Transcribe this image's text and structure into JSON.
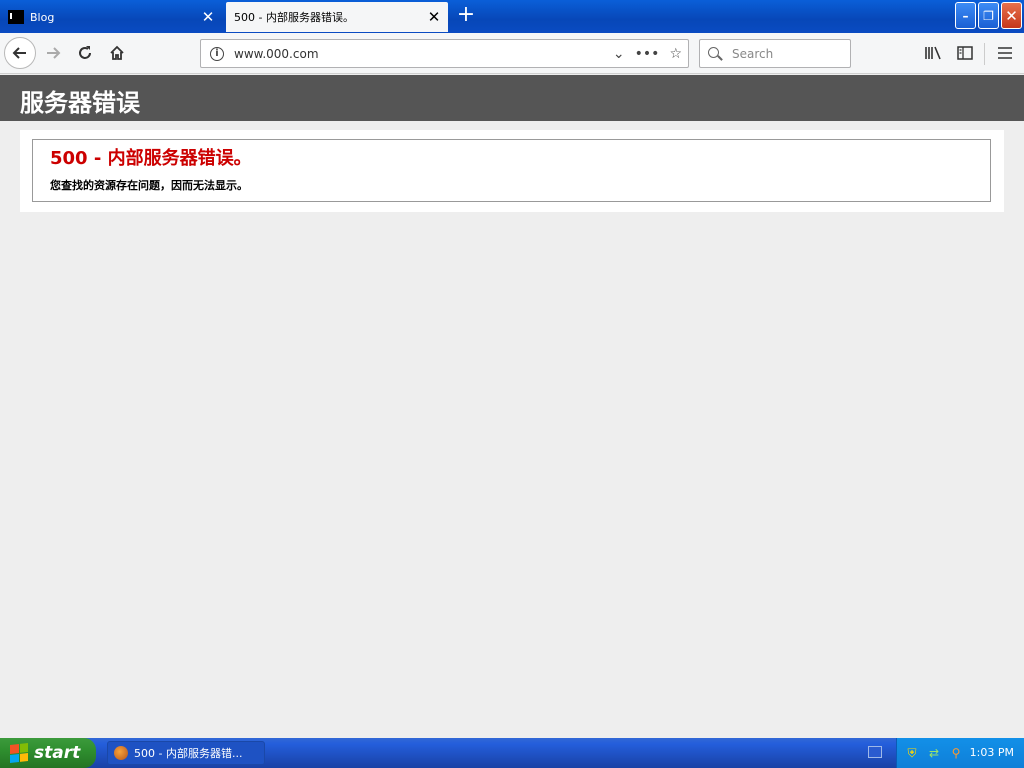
{
  "browser": {
    "tabs": [
      {
        "label": "Blog",
        "active": false
      },
      {
        "label": "500 - 内部服务器错误。",
        "active": true
      }
    ],
    "new_tab_label": "+",
    "url": "www.000.com",
    "search_placeholder": "Search"
  },
  "page": {
    "header_title": "服务器错误",
    "error_title": "500 - 内部服务器错误。",
    "error_description": "您查找的资源存在问题，因而无法显示。"
  },
  "taskbar": {
    "start_label": "start",
    "task_label": "500 - 内部服务器错...",
    "clock": "1:03 PM"
  },
  "colors": {
    "header_bg": "#555555",
    "error_red": "#cc0000",
    "taskbar_blue": "#245edb",
    "start_green": "#2f8f2f"
  }
}
